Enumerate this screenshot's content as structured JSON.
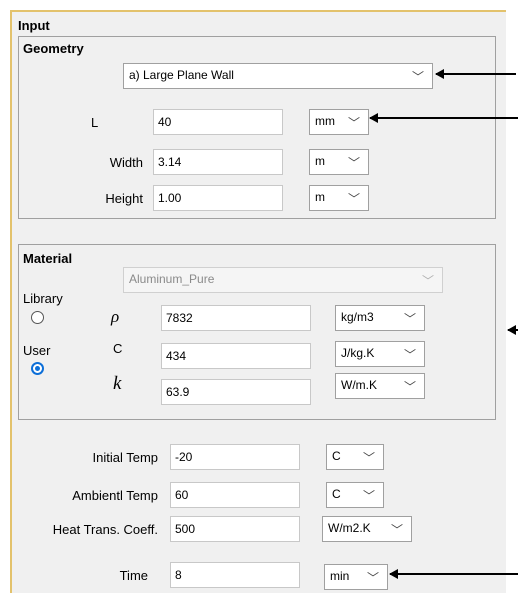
{
  "input_section": {
    "title": "Input"
  },
  "geometry": {
    "title": "Geometry",
    "shape": "a) Large Plane Wall",
    "rows": [
      {
        "label": "L",
        "value": "40",
        "unit": "mm"
      },
      {
        "label": "Width",
        "value": "3.14",
        "unit": "m"
      },
      {
        "label": "Height",
        "value": "1.00",
        "unit": "m"
      }
    ]
  },
  "material": {
    "title": "Material",
    "selected": "Aluminum_Pure",
    "library_label": "Library",
    "user_label": "User",
    "mode": "User",
    "rows": [
      {
        "symbol": "ρ",
        "value": "7832",
        "unit": "kg/m3"
      },
      {
        "symbol": "C",
        "value": "434",
        "unit": "J/kg.K"
      },
      {
        "symbol": "k",
        "value": "63.9",
        "unit": "W/m.K"
      }
    ]
  },
  "conditions": {
    "rows": [
      {
        "label": "Initial Temp",
        "value": "-20",
        "unit": "C"
      },
      {
        "label": "Ambientl Temp",
        "value": "60",
        "unit": "C"
      },
      {
        "label": "Heat Trans. Coeff.",
        "value": "500",
        "unit": "W/m2.K"
      }
    ]
  },
  "time": {
    "label": "Time",
    "value": "8",
    "unit": "min"
  },
  "icons": {
    "dropdown": "chevron-down-icon",
    "pointer": "arrow-left-icon"
  },
  "colors": {
    "frame_accent": "#e3c26c",
    "radio_selected": "#0d6fd8"
  }
}
